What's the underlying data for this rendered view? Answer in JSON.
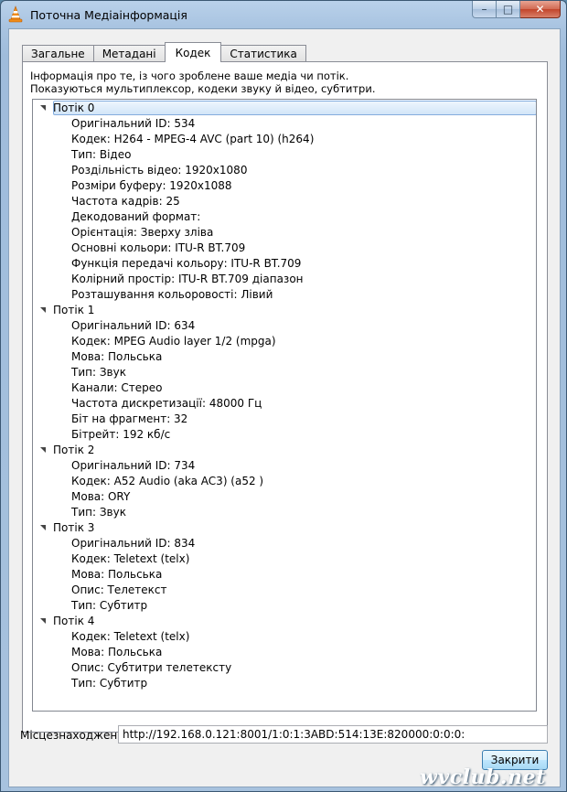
{
  "window": {
    "title": "Поточна Медіаінформація",
    "minimize": "–",
    "maximize": "□",
    "close": "✕"
  },
  "tabs": [
    "Загальне",
    "Метадані",
    "Кодек",
    "Статистика"
  ],
  "active_tab": "Кодек",
  "info": {
    "line1": "Інформація про те, із чого зроблене ваше медіа чи потік.",
    "line2": "Показуються мультиплексор, кодеки звуку й відео, субтитри."
  },
  "streams": [
    {
      "label": "Потік 0",
      "props": [
        "Оригінальний ID: 534",
        "Кодек: H264 - MPEG-4 AVC (part 10) (h264)",
        "Тип: Відео",
        "Роздільність відео: 1920x1080",
        "Розміри буферу: 1920x1088",
        "Частота кадрів: 25",
        "Декодований формат:",
        "Орієнтація: Зверху зліва",
        "Основні кольори: ITU-R BT.709",
        "Функція передачі кольору: ITU-R BT.709",
        "Колірний простір: ITU-R BT.709 діапазон",
        "Розташування кольоровості: Лівий"
      ]
    },
    {
      "label": "Потік 1",
      "props": [
        "Оригінальний ID: 634",
        "Кодек: MPEG Audio layer 1/2 (mpga)",
        "Мова: Польська",
        "Тип: Звук",
        "Канали: Стерео",
        "Частота дискретизації: 48000 Гц",
        "Біт на фрагмент: 32",
        "Бітрейт: 192 кб/с"
      ]
    },
    {
      "label": "Потік 2",
      "props": [
        "Оригінальний ID: 734",
        "Кодек: A52 Audio (aka AC3) (a52 )",
        "Мова: ORY",
        "Тип: Звук"
      ]
    },
    {
      "label": "Потік 3",
      "props": [
        "Оригінальний ID: 834",
        "Кодек: Teletext (telx)",
        "Мова: Польська",
        "Опис: Телетекст",
        "Тип: Субтитр"
      ]
    },
    {
      "label": "Потік 4",
      "props": [
        "Кодек: Teletext (telx)",
        "Мова: Польська",
        "Опис: Субтитри телетексту",
        "Тип: Субтитр"
      ]
    }
  ],
  "location": {
    "label": "Місцезнаходження:",
    "value": "http://192.168.0.121:8001/1:0:1:3ABD:514:13E:820000:0:0:0:"
  },
  "close_button": "Закрити",
  "watermark": "wvclub.net"
}
